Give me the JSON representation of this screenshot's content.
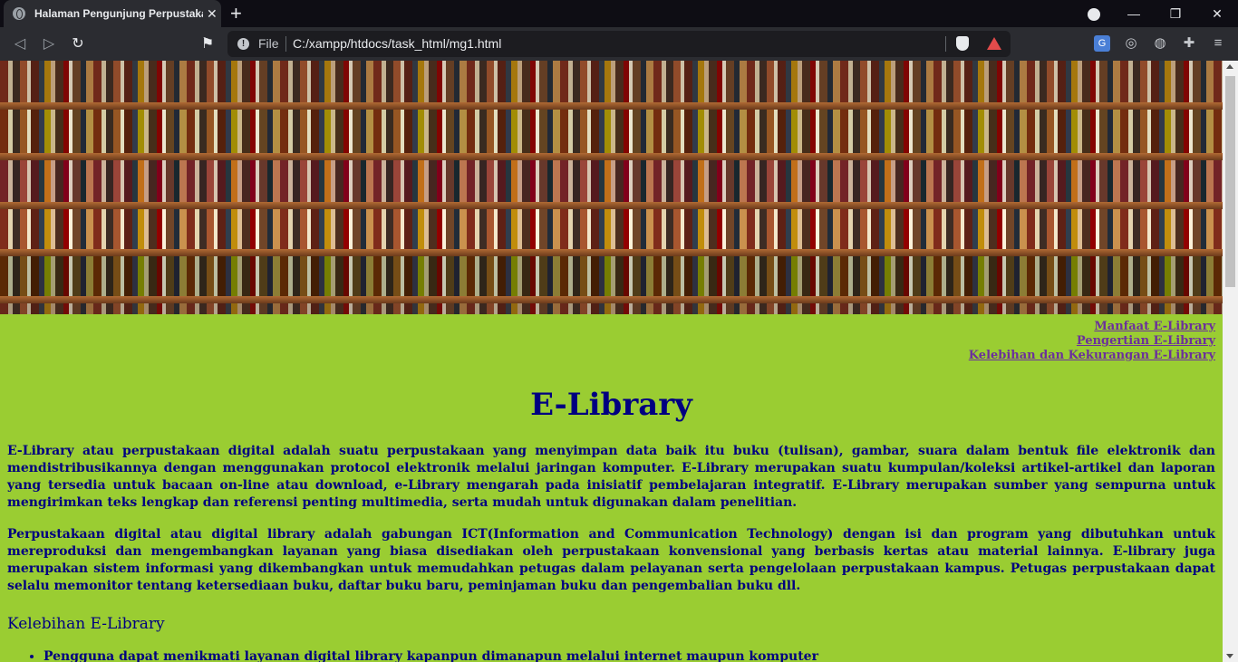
{
  "browser": {
    "tab_title": "Halaman Pengunjung Perpustakaan",
    "file_label": "File",
    "url": "C:/xampp/htdocs/task_html/mg1.html"
  },
  "nav_links": [
    "Manfaat E-Library",
    "Pengertian E-Library",
    "Kelebihan dan Kekurangan E-Library"
  ],
  "heading": "E-Library",
  "paragraphs": [
    "E-Library atau perpustakaan digital adalah suatu perpustakaan yang menyimpan data baik itu buku (tulisan), gambar, suara dalam bentuk file elektronik dan mendistribusikannya dengan menggunakan protocol elektronik melalui jaringan komputer. E-Library merupakan suatu kumpulan/koleksi artikel-artikel dan laporan yang tersedia untuk bacaan on-line atau download, e-Library mengarah pada inisiatif pembelajaran integratif. E-Library merupakan sumber yang sempurna untuk mengirimkan teks lengkap dan referensi penting multimedia, serta mudah untuk digunakan dalam penelitian.",
    "Perpustakaan digital atau digital library adalah gabungan ICT(Information and Communication Technology) dengan isi dan program yang dibutuhkan untuk mereproduksi dan mengembangkan layanan yang biasa disediakan oleh perpustakaan konvensional yang berbasis kertas atau material lainnya. E-library juga merupakan sistem informasi yang dikembangkan untuk memudahkan petugas dalam pelayanan serta pengelolaan perpustakaan kampus. Petugas perpustakaan dapat selalu memonitor tentang ketersediaan buku, daftar buku baru, peminjaman buku dan pengembalian buku dll."
  ],
  "subheading": "Kelebihan E-Library",
  "list_items": [
    "Pengguna dapat menikmati layanan digital library kapanpun dimanapun melalui internet maupun komputer"
  ],
  "colors": {
    "page_bg": "#9acd32",
    "text": "#000080",
    "link": "#6b2f9c"
  }
}
